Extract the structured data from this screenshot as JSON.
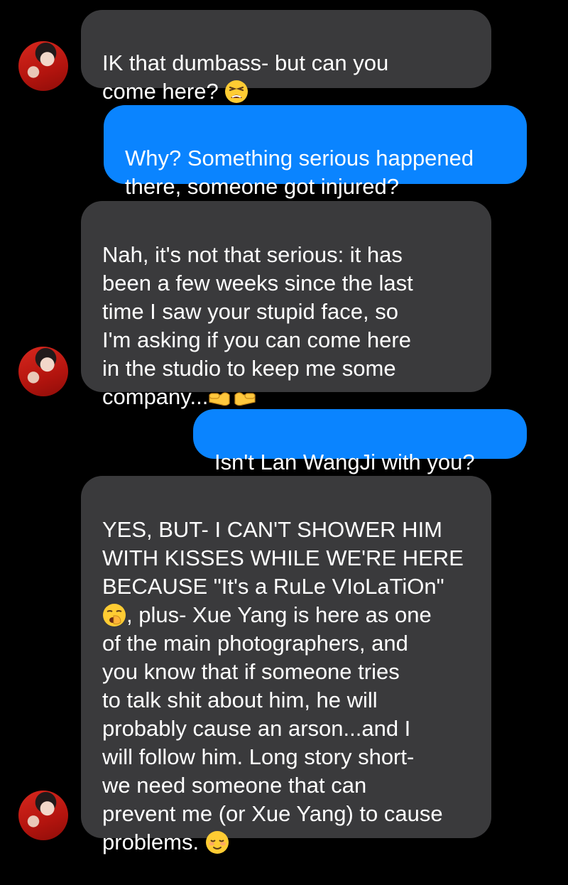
{
  "conversation": {
    "messages": [
      {
        "id": "m1",
        "direction": "incoming",
        "text": "IK that dumbass- but can you\ncome here?",
        "emoji": "tired-face-emoji"
      },
      {
        "id": "m2",
        "direction": "outgoing",
        "text": "Why? Something serious happened\nthere, someone got injured?"
      },
      {
        "id": "m3",
        "direction": "incoming",
        "text": "Nah, it's not that serious: it has\nbeen a few weeks since the last\ntime I saw your stupid face, so\nI'm asking if you can come here\nin the studio to keep me some\ncompany...",
        "emoji": "pointing-fingers-emoji"
      },
      {
        "id": "m4",
        "direction": "outgoing",
        "text": "Isn't Lan WangJi with you?"
      },
      {
        "id": "m5",
        "direction": "incoming",
        "text_before_emoji": "YES, BUT- I CAN'T SHOWER HIM\nWITH KISSES WHILE WE'RE HERE\nBECAUSE \"It's a RuLe VIoLaTiOn\"",
        "emoji": "yawning-face-emoji",
        "text_after_emoji": ", plus- Xue Yang is here as one\nof the main photographers, and\nyou know that if someone tries\nto talk shit about him, he will\nprobably cause an arson...and I\nwill follow him. Long story short-\nwe need someone that can\nprevent me (or Xue Yang) to cause\nproblems.",
        "emoji_end": "relieved-face-emoji"
      }
    ]
  },
  "colors": {
    "background": "#000000",
    "incoming_bubble": "#3a3a3c",
    "outgoing_bubble": "#0a84ff",
    "text": "#ffffff"
  },
  "icons": {
    "avatar": "contact-avatar",
    "tired": "tired-face-emoji",
    "pointing": "pointing-fingers-emoji",
    "yawning": "yawning-face-emoji",
    "relieved": "relieved-face-emoji"
  }
}
